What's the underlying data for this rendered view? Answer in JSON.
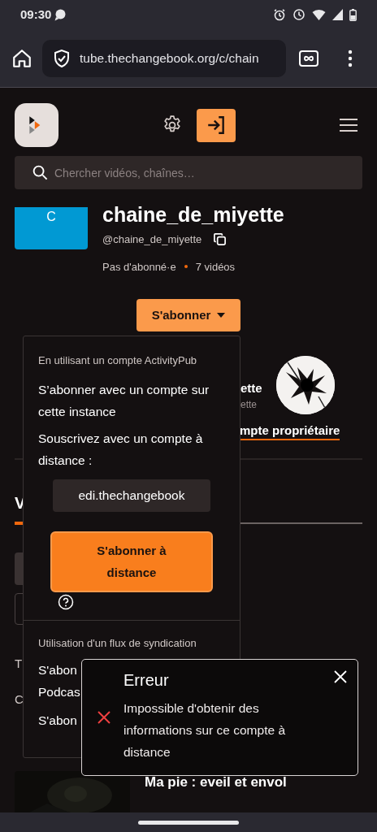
{
  "status_bar": {
    "time": "09:30"
  },
  "browser": {
    "url": "tube.thechangebook.org/c/chain"
  },
  "header": {
    "search_placeholder": "Chercher vidéos, chaînes…"
  },
  "channel": {
    "avatar_letter": "C",
    "name": "chaine_de_miyette",
    "handle": "@chaine_de_miyette",
    "subscribers": "Pas d'abonné·e",
    "videos": "7 vidéos",
    "subscribe_button": "S'abonner"
  },
  "owner": {
    "name": "ette",
    "handle": "ette",
    "link": "mpte propriétaire"
  },
  "tabs": [
    {
      "label": "V",
      "selected": true
    }
  ],
  "sections": [
    "T",
    "C"
  ],
  "videos": [
    {
      "title": "Ma pie : eveil et envol"
    }
  ],
  "subscribe_menu": {
    "activitypub_heading": "En utilisant un compte ActivityPub",
    "local_option": "S’abonner avec un compte sur cette instance",
    "remote_label": "Souscrivez avec un compte à distance :",
    "remote_value": "edi.thechangebook",
    "remote_button": "S'abonner à distance",
    "syndication_heading": "Utilisation d'un flux de syndication",
    "feed_options": [
      "S'abon Podcas",
      "S'abon"
    ]
  },
  "toast": {
    "kind": "error",
    "title": "Erreur",
    "message": "Impossible d'obtenir des informations sur ce compte à distance"
  }
}
